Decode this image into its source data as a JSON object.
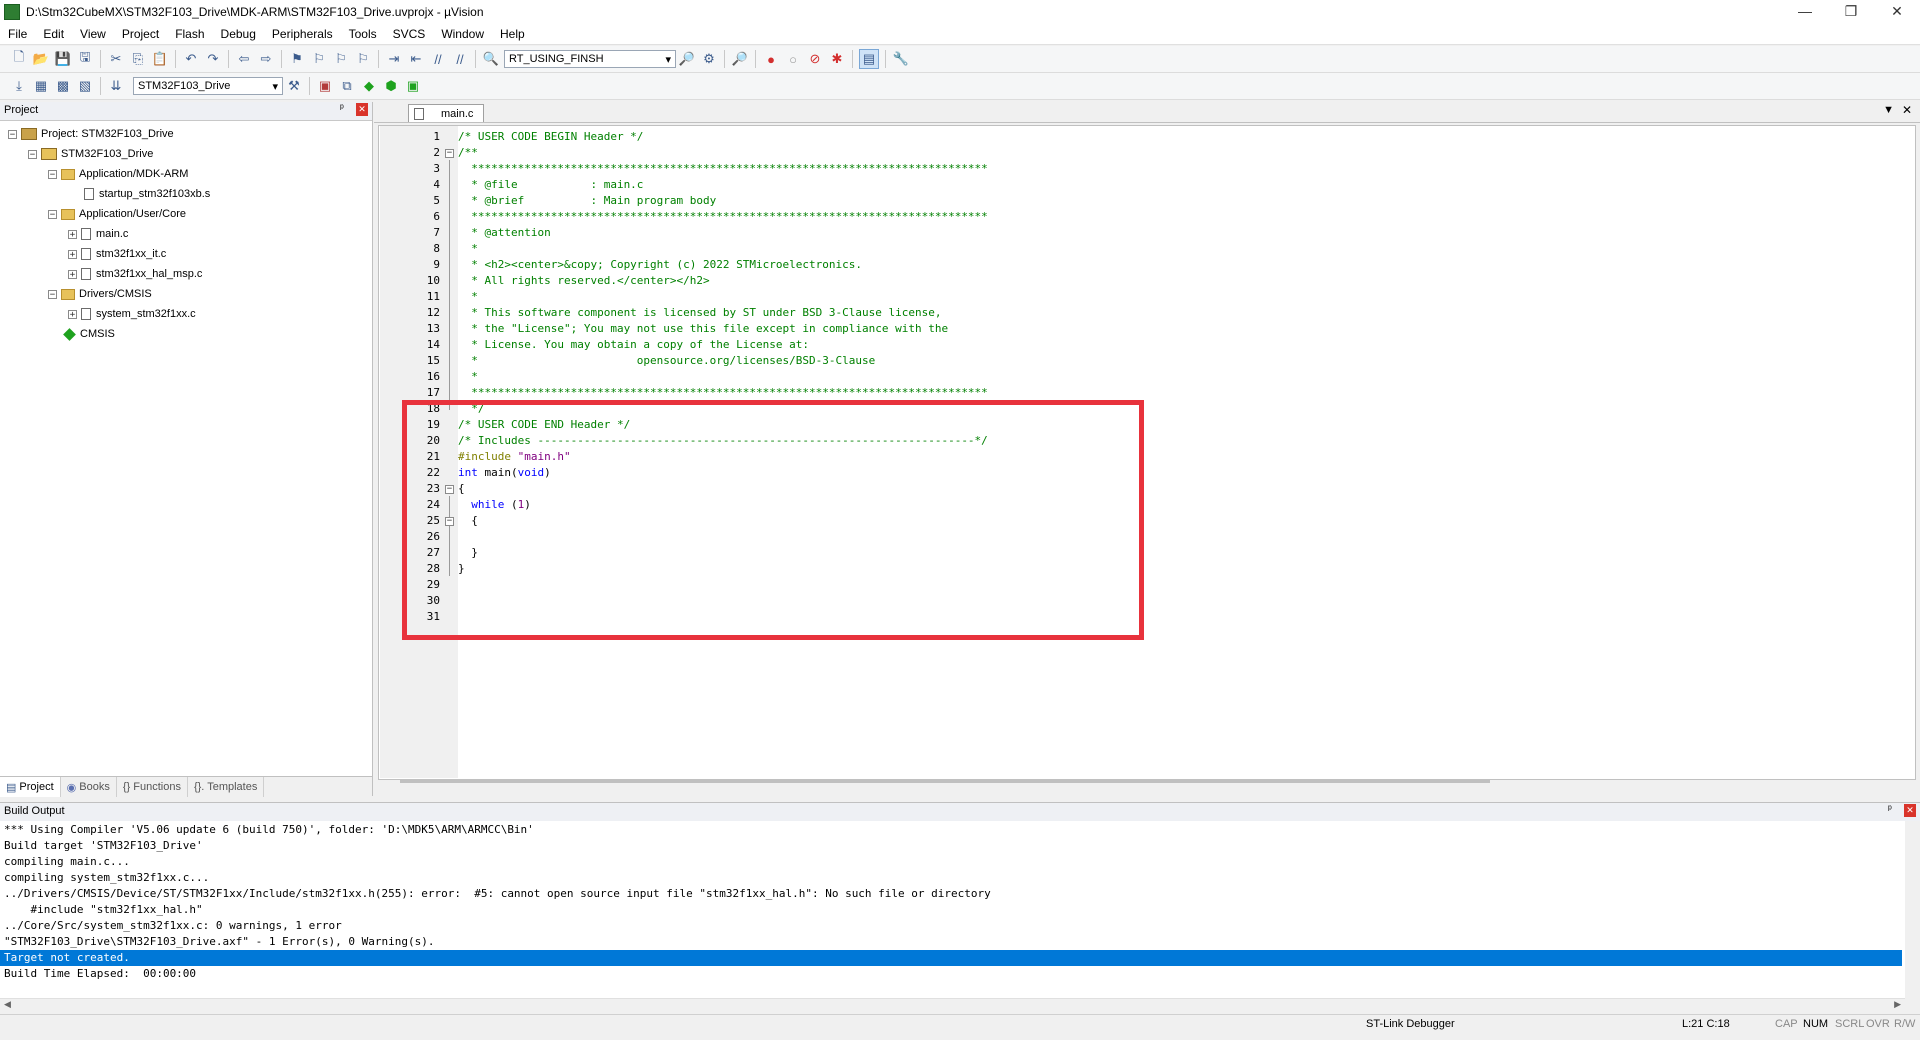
{
  "window": {
    "title": "D:\\Stm32CubeMX\\STM32F103_Drive\\MDK-ARM\\STM32F103_Drive.uvprojx - µVision",
    "minimize": "—",
    "maximize": "❐",
    "close": "✕"
  },
  "menu": [
    "File",
    "Edit",
    "View",
    "Project",
    "Flash",
    "Debug",
    "Peripherals",
    "Tools",
    "SVCS",
    "Window",
    "Help"
  ],
  "toolbar1": {
    "find_combo": "RT_USING_FINSH"
  },
  "toolbar2": {
    "target_combo": "STM32F103_Drive"
  },
  "project_panel": {
    "title": "Project",
    "pin": "ᵖ",
    "close": "✕",
    "tree": [
      {
        "label": "Project: STM32F103_Drive",
        "exp": "−"
      },
      {
        "label": "STM32F103_Drive",
        "exp": "−"
      },
      {
        "label": "Application/MDK-ARM",
        "exp": "−"
      },
      {
        "label": "startup_stm32f103xb.s",
        "exp": ""
      },
      {
        "label": "Application/User/Core",
        "exp": "−"
      },
      {
        "label": "main.c",
        "exp": "+"
      },
      {
        "label": "stm32f1xx_it.c",
        "exp": "+"
      },
      {
        "label": "stm32f1xx_hal_msp.c",
        "exp": "+"
      },
      {
        "label": "Drivers/CMSIS",
        "exp": "−"
      },
      {
        "label": "system_stm32f1xx.c",
        "exp": "+"
      },
      {
        "label": "CMSIS",
        "exp": ""
      }
    ],
    "tabs": [
      "Project",
      "Books",
      "{} Functions",
      "{}. Templates"
    ]
  },
  "editor": {
    "tab": "main.c",
    "lines": [
      [
        "1",
        "/* USER CODE BEGIN Header */"
      ],
      [
        "2",
        "/**"
      ],
      [
        "3",
        "  ******************************************************************************"
      ],
      [
        "4",
        "  * @file           : main.c"
      ],
      [
        "5",
        "  * @brief          : Main program body"
      ],
      [
        "6",
        "  ******************************************************************************"
      ],
      [
        "7",
        "  * @attention"
      ],
      [
        "8",
        "  *"
      ],
      [
        "9",
        "  * <h2><center>&copy; Copyright (c) 2022 STMicroelectronics."
      ],
      [
        "10",
        "  * All rights reserved.</center></h2>"
      ],
      [
        "11",
        "  *"
      ],
      [
        "12",
        "  * This software component is licensed by ST under BSD 3-Clause license,"
      ],
      [
        "13",
        "  * the \"License\"; You may not use this file except in compliance with the"
      ],
      [
        "14",
        "  * License. You may obtain a copy of the License at:"
      ],
      [
        "15",
        "  *                        opensource.org/licenses/BSD-3-Clause"
      ],
      [
        "16",
        "  *"
      ],
      [
        "17",
        "  ******************************************************************************"
      ],
      [
        "18",
        "  */"
      ],
      [
        "19",
        "/* USER CODE END Header */"
      ],
      [
        "20",
        "/* Includes ------------------------------------------------------------------*/"
      ],
      [
        "21",
        "#include \"main.h\""
      ],
      [
        "22",
        "int main(void)"
      ],
      [
        "23",
        "{"
      ],
      [
        "24",
        "  while (1)"
      ],
      [
        "25",
        "  {"
      ],
      [
        "26",
        ""
      ],
      [
        "27",
        "  }"
      ],
      [
        "28",
        "}"
      ],
      [
        "29",
        ""
      ],
      [
        "30",
        ""
      ],
      [
        "31",
        ""
      ]
    ]
  },
  "build_output": {
    "title": "Build Output",
    "lines": [
      "*** Using Compiler 'V5.06 update 6 (build 750)', folder: 'D:\\MDK5\\ARM\\ARMCC\\Bin'",
      "Build target 'STM32F103_Drive'",
      "compiling main.c...",
      "compiling system_stm32f1xx.c...",
      "../Drivers/CMSIS/Device/ST/STM32F1xx/Include/stm32f1xx.h(255): error:  #5: cannot open source input file \"stm32f1xx_hal.h\": No such file or directory",
      "    #include \"stm32f1xx_hal.h\"",
      "../Core/Src/system_stm32f1xx.c: 0 warnings, 1 error",
      "\"STM32F103_Drive\\STM32F103_Drive.axf\" - 1 Error(s), 0 Warning(s).",
      "Target not created.",
      "Build Time Elapsed:  00:00:00"
    ]
  },
  "statusbar": {
    "debugger": "ST-Link Debugger",
    "position": "L:21 C:18",
    "cap": "CAP",
    "num": "NUM",
    "scrl": "SCRL",
    "ovr": "OVR",
    "rw": "R/W"
  },
  "colors": {
    "highlight_box": "#e8323c",
    "selection": "#0078d7",
    "comment": "#008000",
    "keyword": "#0000ff"
  }
}
